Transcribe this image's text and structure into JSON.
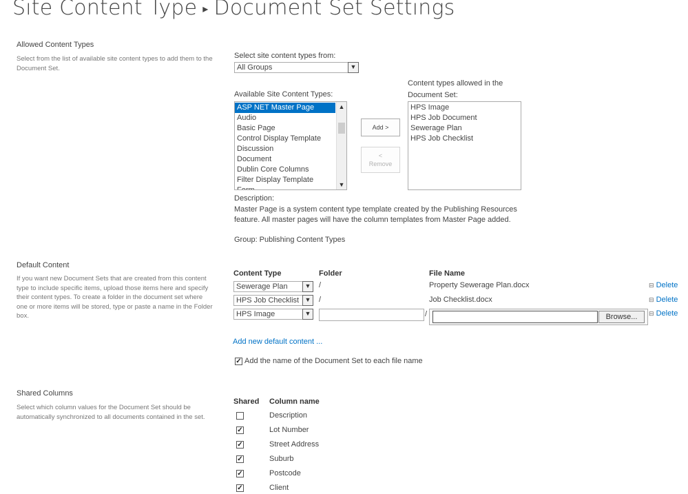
{
  "page": {
    "title_part1": "Site Content Type",
    "title_sep": "▸",
    "title_part2": "Document Set Settings"
  },
  "allowed": {
    "title": "Allowed Content Types",
    "description": "Select from the list of available site content types to add them to the Document Set.",
    "select_from_label": "Select site content types from:",
    "group_value": "All Groups",
    "available_label": "Available Site Content Types:",
    "available_items": [
      "ASP NET Master Page",
      "Audio",
      "Basic Page",
      "Control Display Template",
      "Discussion",
      "Document",
      "Dublin Core Columns",
      "Filter Display Template",
      "Form"
    ],
    "selected_available": "ASP NET Master Page",
    "add_button": "Add >",
    "remove_arrow": "<",
    "remove_button": "Remove",
    "allowed_label_line1": "Content types allowed in the",
    "allowed_label_line2": "Document Set:",
    "allowed_items": [
      "HPS Image",
      "HPS Job Document",
      "Sewerage Plan",
      "HPS Job Checklist"
    ],
    "description_label": "Description:",
    "description_text_line1": "Master Page is a system content type template created by the Publishing Resources",
    "description_text_line2": "feature. All master pages will have the column templates from Master Page added.",
    "group_text": "Group: Publishing Content Types"
  },
  "default_content": {
    "title": "Default Content",
    "description": "If you want new Document Sets that are created from this content type to include specific items, upload those items here and specify their content types. To create a folder in the document set where one or more items will be stored, type or paste a name in the Folder box.",
    "col_content_type": "Content Type",
    "col_folder": "Folder",
    "col_file_name": "File Name",
    "rows": [
      {
        "content_type": "Sewerage Plan",
        "folder": "/",
        "file_name": "Property Sewerage Plan.docx",
        "delete": "Delete"
      },
      {
        "content_type": "HPS Job Checklist",
        "folder": "/",
        "file_name": "Job Checklist.docx",
        "delete": "Delete"
      },
      {
        "content_type": "HPS Image",
        "folder": "/",
        "file_name": "",
        "delete": "Delete"
      }
    ],
    "browse_button": "Browse...",
    "add_new_link": "Add new default content ...",
    "add_name_checkbox_label": "Add the name of the Document Set to each file name",
    "add_name_checked": true
  },
  "shared_columns": {
    "title": "Shared Columns",
    "description": "Select which column values for the Document Set should be automatically synchronized to all documents contained in the set.",
    "col_shared": "Shared",
    "col_column_name": "Column name",
    "columns": [
      {
        "name": "Description",
        "checked": false
      },
      {
        "name": "Lot Number",
        "checked": true
      },
      {
        "name": "Street Address",
        "checked": true
      },
      {
        "name": "Suburb",
        "checked": true
      },
      {
        "name": "Postcode",
        "checked": true
      },
      {
        "name": "Client",
        "checked": true
      }
    ]
  },
  "icons": {
    "dropdown": "chevron-down-icon",
    "scroll_up": "scroll-up-arrow-icon",
    "scroll_down": "scroll-down-arrow-icon",
    "delete": "delete-icon",
    "check": "checkmark-icon"
  },
  "colors": {
    "accent": "#0072c6",
    "text": "#444444",
    "muted": "#777777"
  }
}
